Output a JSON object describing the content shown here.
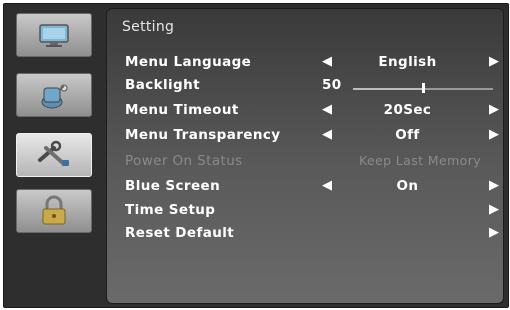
{
  "title": "Setting",
  "backlight": {
    "value": 50,
    "max": 100
  },
  "menu": [
    {
      "label": "Menu Language",
      "value": "English",
      "left_arrow": "◀",
      "right_arrow": "▶",
      "enabled": true
    },
    {
      "label": "Backlight",
      "value": "50",
      "enabled": true
    },
    {
      "label": "Menu Timeout",
      "value": "20Sec",
      "left_arrow": "◀",
      "right_arrow": "▶",
      "enabled": true
    },
    {
      "label": "Menu Transparency",
      "value": "Off",
      "left_arrow": "◀",
      "right_arrow": "▶",
      "enabled": true
    },
    {
      "label": "Power On Status",
      "value": "Keep Last Memory",
      "enabled": false
    },
    {
      "label": "Blue Screen",
      "value": "On",
      "left_arrow": "◀",
      "right_arrow": "▶",
      "enabled": true
    },
    {
      "label": "Time Setup",
      "right_arrow": "▶",
      "enabled": true
    },
    {
      "label": "Reset Default",
      "right_arrow": "▶",
      "enabled": true
    }
  ],
  "sidebar": {
    "items": [
      {
        "icon": "monitor-icon"
      },
      {
        "icon": "speaker-icon"
      },
      {
        "icon": "tools-icon",
        "active": true
      },
      {
        "icon": "lock-icon"
      }
    ]
  },
  "colors": {
    "panel": "#4a4a4a",
    "text": "#ffffff",
    "disabled_text": "#8a8a8a"
  }
}
